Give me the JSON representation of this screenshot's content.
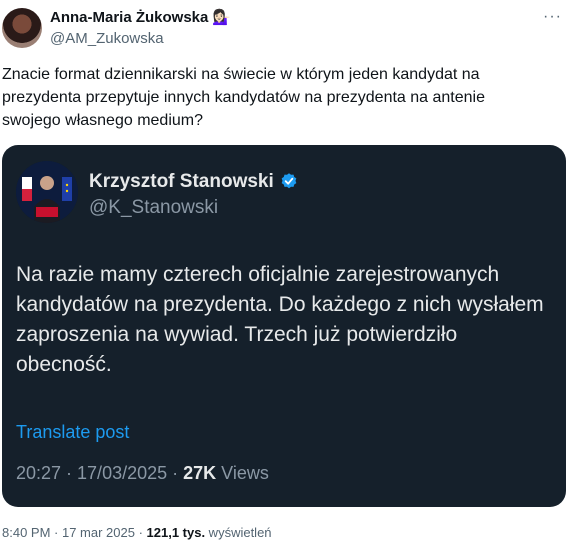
{
  "author": {
    "display_name": "Anna-Maria Żukowska",
    "handle": "@AM_Zukowska",
    "emoji": "💁🏻‍♀️"
  },
  "more_label": "···",
  "tweet": {
    "text": "Znacie format dziennikarski na świecie w którym jeden kandydat na prezydenta przepytuje innych kandydatów na prezydenta na antenie swojego własnego medium?"
  },
  "quoted": {
    "display_name": "Krzysztof Stanowski",
    "handle": "@K_Stanowski",
    "text": "Na razie mamy czterech oficjalnie zarejestrowanych kandydatów na prezydenta. Do każdego z nich wysłałem zaproszenia na wywiad. Trzech już potwierdziło obecność.",
    "translate_label": "Translate post",
    "timestamp": "20:27 · 17/03/2025 · ",
    "views_count": "27K",
    "views_label": " Views"
  },
  "footer": {
    "timestamp": "8:40 PM · 17 mar 2025 · ",
    "views_count": "121,1 tys.",
    "views_label": " wyświetleń"
  },
  "colors": {
    "card_bg": "#15202b",
    "accent": "#1d9bf0",
    "secondary_text": "#536471"
  }
}
